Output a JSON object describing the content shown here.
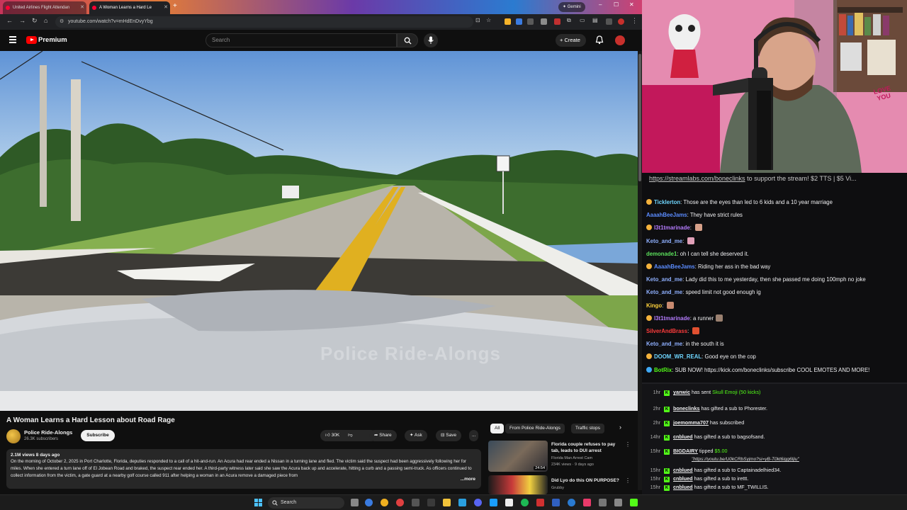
{
  "browser": {
    "tabs": [
      {
        "label": "United Airlines Flight Attendan"
      },
      {
        "label": "A Woman Learns a Hard Le"
      }
    ],
    "new_tab": "+",
    "gemini_label": "Gemini",
    "url": "youtube.com/watch?v=mHdEnDvyYbg"
  },
  "youtube": {
    "brand": "Premium",
    "search_placeholder": "Search",
    "create_label": "Create",
    "watermark": "Police Ride-Alongs",
    "video_title": "A Woman Learns a Hard Lesson about Road Rage",
    "channel_name": "Police Ride-Alongs",
    "channel_subs": "26.3K subscribers",
    "subscribe_label": "Subscribe",
    "actions": {
      "likes": "30K",
      "share": "Share",
      "ask": "Ask",
      "save": "Save",
      "more": "..."
    },
    "description": {
      "meta": "2.1M views  8 days ago",
      "text": "On the morning of October 2, 2025 in Port Charlotte, Florida, deputies responded to a call of a hit-and-run. An Acura had rear ended a Nissan in a turning lane and fled. The victim said the suspect had been aggressively following her for miles. When she entered a turn lane off of El Jobean Road and braked, the suspect rear ended her. A third-party witness later said she saw the Acura back up and accelerate, hitting a curb and a passing semi-truck. As officers continued to collect information from the victim, a gate guard at a nearby golf course called 911 after helping a woman in an Acura remove a damaged piece from",
      "more": "...more"
    },
    "chips": [
      "All",
      "From Police Ride-Alongs",
      "Traffic stops"
    ],
    "chip_next": "›",
    "recommendations": [
      {
        "title": "Florida couple refuses to pay tab, leads to DUI arrest",
        "channel": "Florida Man Arrest Cam",
        "stats": "234K views · 9 days ago",
        "duration": "24:54"
      },
      {
        "title": "Did Lyo do this ON PURPOSE?",
        "channel": "Grubby",
        "stats": "",
        "duration": ""
      }
    ],
    "rec_more": "⋮"
  },
  "webcam": {
    "love_sign": "LOVE YOU"
  },
  "chat": {
    "banner_link": "https://streamlabs.com/boneclinks",
    "banner_text": " to support the stream! $2 TTS | $5 Vi...",
    "messages": [
      {
        "user": "Ticklerton",
        "color": "#6fd6ff",
        "text": "Those are the eyes than led to 6 kids and a 10 year marriage",
        "badge": "#f4b23c"
      },
      {
        "user": "AaaahBeeJams",
        "color": "#5b8cff",
        "text": "They have strict rules",
        "badge": ""
      },
      {
        "user": "l3t1tmarinade",
        "color": "#b57cff",
        "text": "",
        "badge": "#f4b23c",
        "emote": "#d6a089"
      },
      {
        "user": "Keto_and_me",
        "color": "#8fb0ff",
        "text": "",
        "badge": "",
        "emote": "#e0a0b8"
      },
      {
        "user": "demonade1",
        "color": "#5ce05c",
        "text": "oh I can tell she deserved it.",
        "badge": ""
      },
      {
        "user": "AaaahBeeJams",
        "color": "#5b8cff",
        "text": "Riding her ass in the bad way",
        "badge": "#f4b23c"
      },
      {
        "user": "Keto_and_me",
        "color": "#8fb0ff",
        "text": "Lady did this to me yesterday, then she passed me doing 100mph no joke",
        "badge": ""
      },
      {
        "user": "Keto_and_me",
        "color": "#8fb0ff",
        "text": "speed limit not good enough ig",
        "badge": ""
      },
      {
        "user": "Kingo",
        "color": "#ffd23c",
        "text": "",
        "badge": "",
        "emote": "#c88a70"
      },
      {
        "user": "l3t1tmarinade",
        "color": "#b57cff",
        "text": "a runner",
        "badge": "#f4b23c",
        "emote": "#9a8070"
      },
      {
        "user": "SilverAndBrass",
        "color": "#ff3c3c",
        "text": "",
        "badge": "",
        "emote": "#e05030"
      },
      {
        "user": "Keto_and_me",
        "color": "#8fb0ff",
        "text": "in the south it is",
        "badge": ""
      },
      {
        "user": "DOOM_WR_REAL",
        "color": "#6fd6ff",
        "text": "Good eye on the cop",
        "badge": "#f4b23c"
      },
      {
        "user": "BotRix",
        "color": "#53fc18",
        "text": "SUB NOW! https://kick.com/boneclinks/subscribe COOL EMOTES AND MORE!",
        "badge": "#3fa9f5"
      }
    ]
  },
  "feed": {
    "events": [
      {
        "time": "1hr",
        "who": "yanwic",
        "action": " has sent ",
        "highlight": "Skull Emoji (50 kicks)"
      },
      {
        "time": "2hr",
        "who": "boneclinks",
        "action": " has gifted a sub to Phorester.",
        "highlight": ""
      },
      {
        "time": "2hr",
        "who": "joemomma707",
        "action": " has subscribed",
        "highlight": ""
      },
      {
        "time": "14hr",
        "who": "cnblued",
        "action": " has gifted a sub to bagsofsand.",
        "highlight": ""
      },
      {
        "time": "15hr",
        "who": "BIGDAIRY",
        "action": " tipped ",
        "highlight": "$5.00"
      },
      {
        "time": "15hr",
        "who": "cnblued",
        "action": " has gifted a sub to Captainadelhied34.",
        "highlight": ""
      },
      {
        "time": "15hr",
        "who": "cnblued",
        "action": " has gifted a sub to irettt.",
        "highlight": ""
      },
      {
        "time": "15hr",
        "who": "cnblued",
        "action": " has gifted a sub to MF_TWILLIS.",
        "highlight": ""
      }
    ],
    "tip_url": "\"https://youtu.be/U0kCRbSyjmo?si=yB-T0kt6igg6ljiu\""
  },
  "taskbar": {
    "search_label": "Search"
  }
}
